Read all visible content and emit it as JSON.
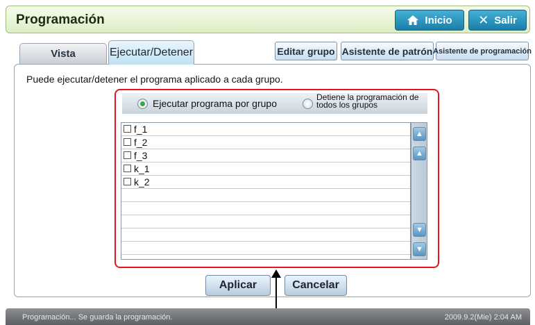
{
  "header": {
    "title": "Programación",
    "inicio_label": "Inicio",
    "salir_label": "Salir"
  },
  "tabs": [
    {
      "label": "Vista",
      "active": false
    },
    {
      "label": "Ejecutar/Detener",
      "active": true
    }
  ],
  "toolbar": {
    "edit_group": "Editar grupo",
    "pattern_wizard": "Asistente de patrón",
    "schedule_wizard": "Asistente de programación"
  },
  "description": "Puede ejecutar/detener el programa aplicado a cada grupo.",
  "mode": {
    "run_by_group": "Ejecutar programa por grupo",
    "stop_all_line1": "Detiene la programación de",
    "stop_all_line2": "todos los grupos",
    "selected": "run_by_group"
  },
  "groups": [
    {
      "label": "f_1",
      "checked": false
    },
    {
      "label": "f_2",
      "checked": false
    },
    {
      "label": "f_3",
      "checked": false
    },
    {
      "label": "k_1",
      "checked": false
    },
    {
      "label": "k_2",
      "checked": false
    }
  ],
  "actions": {
    "apply": "Aplicar",
    "cancel": "Cancelar"
  },
  "status": {
    "message": "Programación... Se guarda la programación.",
    "datetime": "2009.9.2(Mie)  2:04 AM"
  },
  "colors": {
    "accent_blue": "#1b7ea8",
    "highlight_red": "#e3141e",
    "radio_green": "#3aa64a"
  }
}
